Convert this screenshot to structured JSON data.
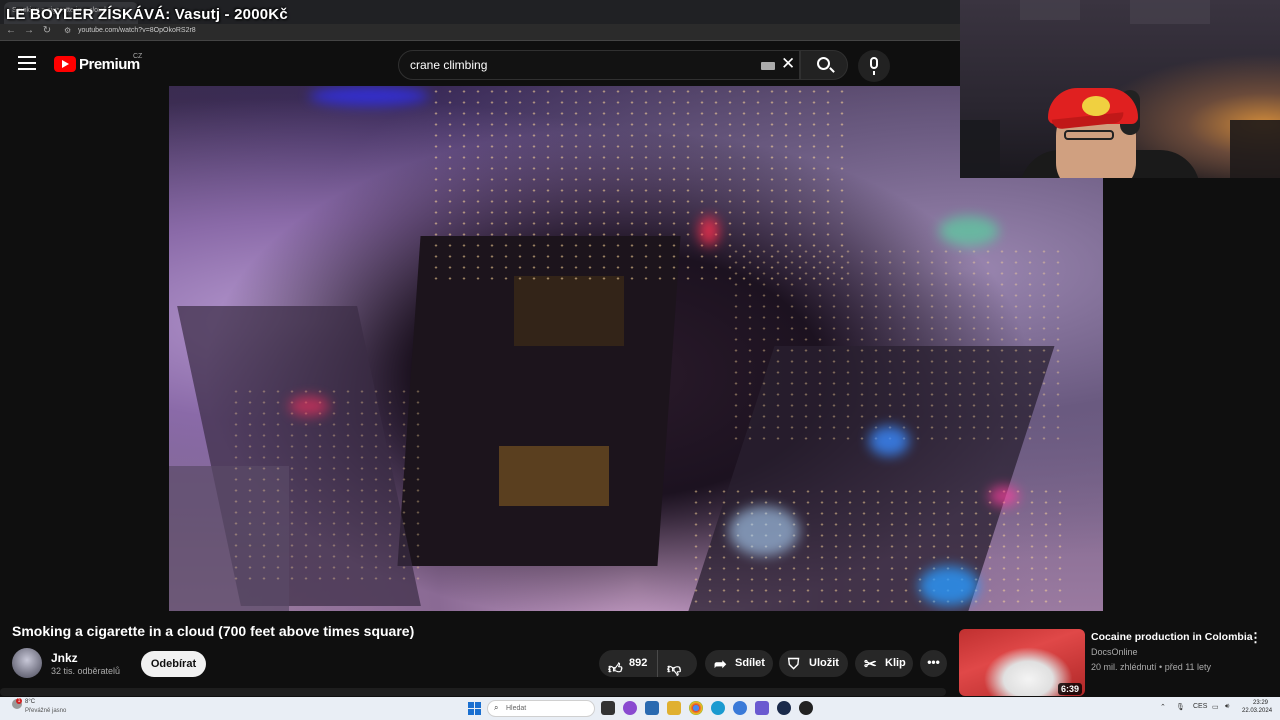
{
  "stream_overlay": {
    "title": "LE BOYLER ZÍSKÁVÁ: Vasutj - 2000Kč"
  },
  "browser": {
    "tab_label": "Smoking a cigarette in a cloud",
    "url": "youtube.com/watch?v=8OpOkoRS2r8",
    "back_icon": "arrow-left-icon",
    "forward_icon": "arrow-right-icon",
    "reload_icon": "reload-icon"
  },
  "header": {
    "logo_text": "Premium",
    "country_code": "CZ",
    "search_value": "crane climbing"
  },
  "video": {
    "title": "Smoking a cigarette in a cloud (700 feet above times square)",
    "channel": "Jnkz",
    "subscribers": "32 tis. odběratelů",
    "subscribe_label": "Odebírat",
    "like_count": "892",
    "share_label": "Sdílet",
    "save_label": "Uložit",
    "clip_label": "Klip",
    "more_label": "•••"
  },
  "recommendation": {
    "title": "Cocaine production in Colombia",
    "channel": "DocsOnline",
    "meta": "20 mil. zhlédnutí • před 11 lety",
    "duration": "6:39",
    "menu_label": "⋮"
  },
  "taskbar": {
    "weather_temp": "8°C",
    "weather_desc": "Převážně jasno",
    "weather_badge": "1",
    "search_placeholder": "Hledat",
    "language": "CES",
    "time": "23:29",
    "date": "22.03.2024"
  },
  "colors": {
    "youtube_red": "#ff0000",
    "background": "#0f0f0f",
    "pill": "#272727",
    "taskbar": "#e9eef5"
  }
}
